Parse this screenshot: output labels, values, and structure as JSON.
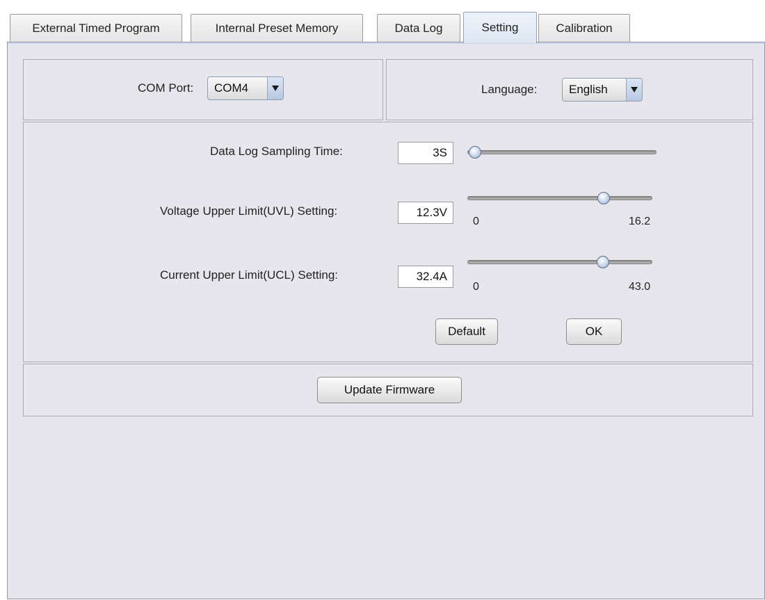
{
  "tabs": [
    {
      "label": "External Timed Program"
    },
    {
      "label": "Internal Preset Memory"
    },
    {
      "label": "Data Log"
    },
    {
      "label": "Setting"
    },
    {
      "label": "Calibration"
    }
  ],
  "active_tab": "Setting",
  "com_port": {
    "label": "COM Port:",
    "value": "COM4"
  },
  "language": {
    "label": "Language:",
    "value": "English"
  },
  "sampling": {
    "label": "Data Log Sampling Time:",
    "value": "3S",
    "slider_fraction": 0.0
  },
  "uvl": {
    "label": "Voltage Upper Limit(UVL) Setting:",
    "value": "12.3V",
    "min": "0",
    "max": "16.2",
    "slider_value": 12.3
  },
  "ucl": {
    "label": "Current Upper Limit(UCL) Setting:",
    "value": "32.4A",
    "min": "0",
    "max": "43.0",
    "slider_value": 32.4
  },
  "buttons": {
    "default": "Default",
    "ok": "OK",
    "update_firmware": "Update Firmware"
  }
}
